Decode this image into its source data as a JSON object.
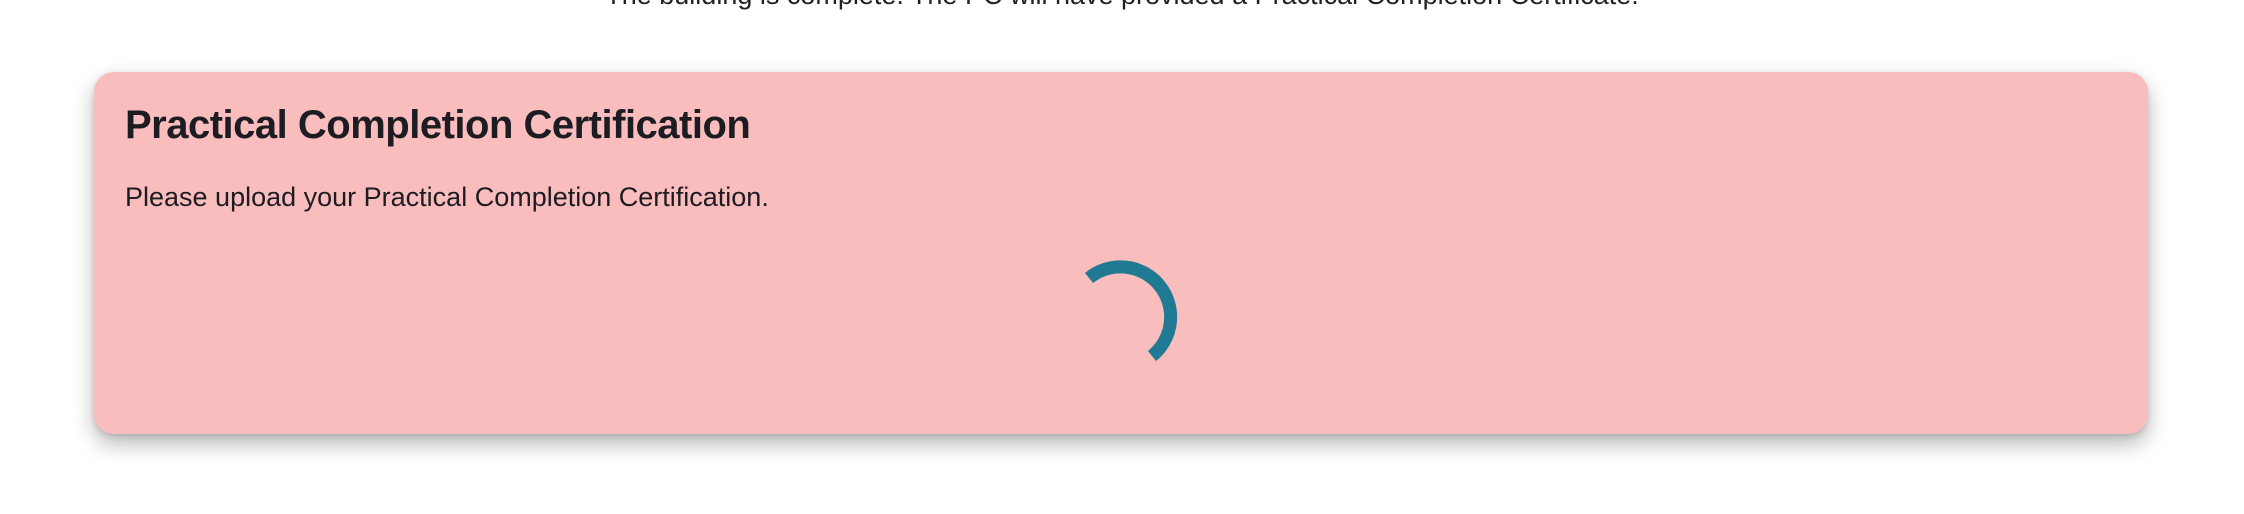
{
  "top_description": "The building is complete. The PC will have provided a Practical Completion Certificate.",
  "card": {
    "title": "Practical Completion Certification",
    "instruction": "Please upload your Practical Completion Certification.",
    "background_color": "#f9bdbd"
  },
  "spinner": {
    "icon": "loading-spinner-icon",
    "color": "#217a94"
  }
}
